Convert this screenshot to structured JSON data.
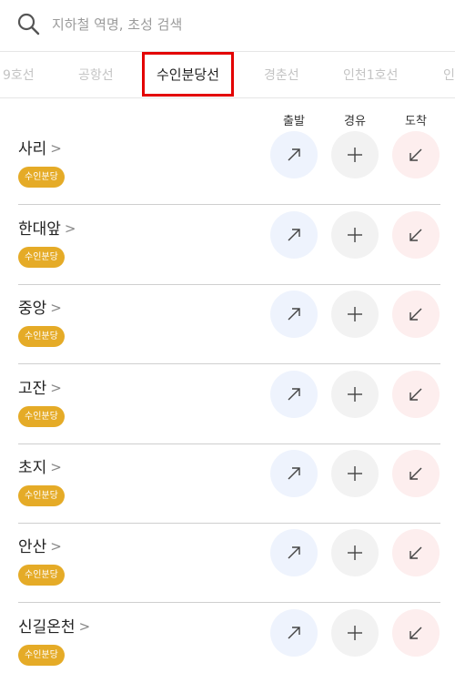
{
  "search": {
    "placeholder": "지하철 역명, 초성 검색",
    "icon": "search-icon"
  },
  "tabs": [
    {
      "label": "9호선",
      "active": false
    },
    {
      "label": "공항선",
      "active": false
    },
    {
      "label": "수인분당선",
      "active": true
    },
    {
      "label": "경춘선",
      "active": false
    },
    {
      "label": "인천1호선",
      "active": false
    },
    {
      "label": "인",
      "active": false
    }
  ],
  "columns": {
    "depart": "출발",
    "via": "경유",
    "arrive": "도착"
  },
  "stations": [
    {
      "name": "사리",
      "badge": "수인분당"
    },
    {
      "name": "한대앞",
      "badge": "수인분당"
    },
    {
      "name": "중앙",
      "badge": "수인분당"
    },
    {
      "name": "고잔",
      "badge": "수인분당"
    },
    {
      "name": "초지",
      "badge": "수인분당"
    },
    {
      "name": "안산",
      "badge": "수인분당"
    },
    {
      "name": "신길온천",
      "badge": "수인분당"
    }
  ],
  "colors": {
    "badge": "#e5ab27",
    "depart_bg": "#eef3fd",
    "via_bg": "#f2f2f2",
    "arrive_bg": "#fdeeee",
    "highlight": "#e30000"
  }
}
